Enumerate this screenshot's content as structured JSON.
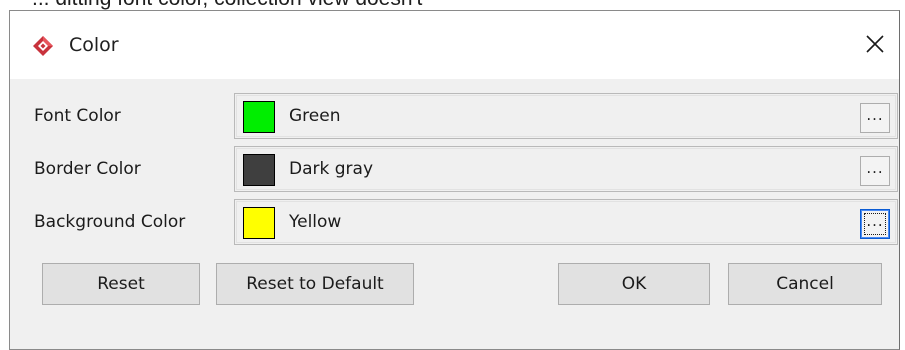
{
  "caption": "... ditting font color, collection view doesn't",
  "dialog": {
    "title": "Color",
    "icon": "app-logo-icon",
    "close_glyph": "✕",
    "rows": [
      {
        "label": "Font Color",
        "value": "Green",
        "swatch": "#00ee00",
        "button_label": "..."
      },
      {
        "label": "Border Color",
        "value": "Dark gray",
        "swatch": "#3f3f3f",
        "button_label": "..."
      },
      {
        "label": "Background Color",
        "value": "Yellow",
        "swatch": "#ffff00",
        "button_label": "..."
      }
    ],
    "buttons": {
      "reset": "Reset",
      "reset_default": "Reset to Default",
      "ok": "OK",
      "cancel": "Cancel"
    }
  }
}
